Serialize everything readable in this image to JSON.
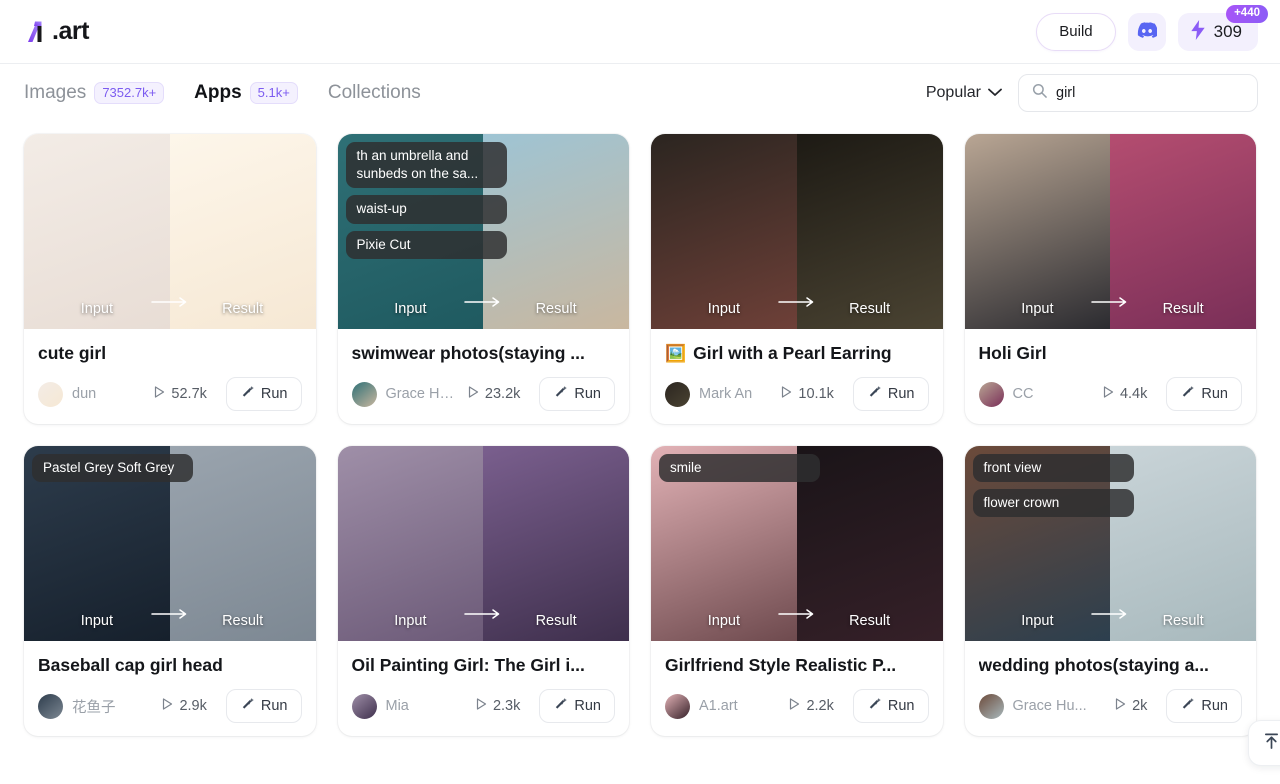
{
  "header": {
    "logo_text": ".art",
    "logo_icon": "a1-logo-icon",
    "build_label": "Build",
    "discord_icon": "discord-icon",
    "credits_icon": "lightning-bolt-icon",
    "credits_value": "309",
    "credits_badge": "+440"
  },
  "filterbar": {
    "tabs": [
      {
        "label": "Images",
        "count": "7352.7k+",
        "active": false
      },
      {
        "label": "Apps",
        "count": "5.1k+",
        "active": true
      },
      {
        "label": "Collections",
        "count": "",
        "active": false
      }
    ],
    "sort": {
      "label": "Popular",
      "icon": "chevron-down-icon"
    },
    "search": {
      "value": "girl",
      "placeholder": "Search",
      "icon": "search-icon"
    }
  },
  "thumb_labels": {
    "input": "Input",
    "result": "Result",
    "arrow": "arrow-right-icon"
  },
  "cards": [
    {
      "title": "cute girl",
      "emoji": "",
      "author": "dun",
      "runs": "52.7k",
      "run_label": "Run",
      "chips": [],
      "input_colors": [
        "#f3ece6",
        "#e8ddd5"
      ],
      "result_colors": [
        "#fdf6ea",
        "#f6e8d4"
      ]
    },
    {
      "title": "swimwear photos(staying ...",
      "emoji": "",
      "author": "Grace Hu...",
      "runs": "23.2k",
      "run_label": "Run",
      "chips": [
        "th an umbrella and sunbeds on the sa...",
        "waist-up",
        "Pixie Cut"
      ],
      "input_colors": [
        "#2f7076",
        "#1f5a60"
      ],
      "result_colors": [
        "#9ec4d4",
        "#c9b79f"
      ]
    },
    {
      "title": "Girl with a Pearl Earring",
      "emoji": "🖼️",
      "author": "Mark An",
      "runs": "10.1k",
      "run_label": "Run",
      "chips": [],
      "input_colors": [
        "#2b2520",
        "#6e4038"
      ],
      "result_colors": [
        "#1d1a14",
        "#4a4332"
      ]
    },
    {
      "title": "Holi Girl",
      "emoji": "",
      "author": "CC",
      "runs": "4.4k",
      "run_label": "Run",
      "chips": [],
      "input_colors": [
        "#b9a694",
        "#2b2b30"
      ],
      "result_colors": [
        "#b44d70",
        "#7a2f58"
      ]
    },
    {
      "title": "Baseball cap girl head",
      "emoji": "",
      "author": "花鱼子",
      "runs": "2.9k",
      "run_label": "Run",
      "chips": [
        "Pastel Grey Soft Grey"
      ],
      "input_colors": [
        "#2d3c4c",
        "#16202c"
      ],
      "result_colors": [
        "#9aa4ae",
        "#7d8893"
      ]
    },
    {
      "title": "Oil Painting Girl: The Girl i...",
      "emoji": "",
      "author": "Mia",
      "runs": "2.3k",
      "run_label": "Run",
      "chips": [],
      "input_colors": [
        "#9f8fa8",
        "#6c5a78"
      ],
      "result_colors": [
        "#7a5f8e",
        "#3e2f4c"
      ]
    },
    {
      "title": "Girlfriend Style Realistic P...",
      "emoji": "",
      "author": "A1.art",
      "runs": "2.2k",
      "run_label": "Run",
      "chips": [
        "smile"
      ],
      "input_colors": [
        "#e2b2b6",
        "#6e4a4e"
      ],
      "result_colors": [
        "#1a1418",
        "#352028"
      ]
    },
    {
      "title": "wedding photos(staying a...",
      "emoji": "",
      "author": "Grace Hu...",
      "runs": "2k",
      "run_label": "Run",
      "chips": [
        "front view",
        "flower crown"
      ],
      "input_colors": [
        "#6c4a3a",
        "#2c3f4e"
      ],
      "result_colors": [
        "#c9d4d8",
        "#a8b9bd"
      ]
    }
  ],
  "scroll_top": {
    "icon": "arrow-up-to-line-icon"
  },
  "colors": {
    "accent": "#7c5cf0",
    "badge_gradient_start": "#a855f7",
    "badge_gradient_end": "#8b5cf6",
    "discord_blue": "#5865f2"
  }
}
